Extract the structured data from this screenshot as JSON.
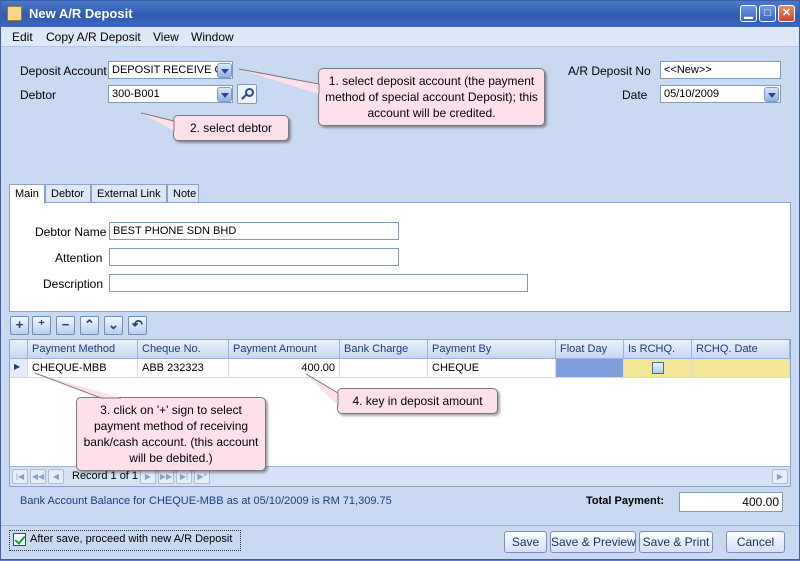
{
  "window": {
    "title": "New A/R Deposit",
    "buttons": [
      "minimize",
      "maximize",
      "close"
    ]
  },
  "menu": [
    "Edit",
    "Copy A/R Deposit",
    "View",
    "Window"
  ],
  "header": {
    "deposit_account_label": "Deposit Account",
    "deposit_account_value": "DEPOSIT RECEIVE CH",
    "debtor_label": "Debtor",
    "debtor_value": "300-B001",
    "ar_deposit_no_label": "A/R Deposit No",
    "ar_deposit_no_value": "<<New>>",
    "date_label": "Date",
    "date_value": "05/10/2009"
  },
  "callouts": {
    "c1": "1. select deposit account (the payment method of special account Deposit); this account will be credited.",
    "c2": "2. select debtor",
    "c3": "3. click on '+' sign to select payment method of receiving bank/cash account. (this account will be debited.)",
    "c4": "4. key in deposit amount"
  },
  "tabs": [
    "Main",
    "Debtor",
    "External Link",
    "Note"
  ],
  "main_tab": {
    "debtor_name_label": "Debtor Name",
    "debtor_name_value": "BEST PHONE SDN BHD",
    "attention_label": "Attention",
    "attention_value": "",
    "description_label": "Description",
    "description_value": ""
  },
  "grid": {
    "columns": [
      "Payment Method",
      "Cheque No.",
      "Payment Amount",
      "Bank Charge",
      "Payment By",
      "Float Day",
      "Is RCHQ.",
      "RCHQ. Date"
    ],
    "rows": [
      {
        "payment_method": "CHEQUE-MBB",
        "cheque_no": "ABB 232323",
        "payment_amount": "400.00",
        "bank_charge": "",
        "payment_by": "CHEQUE",
        "float_day": "",
        "is_rchq": false,
        "rchq_date": ""
      }
    ],
    "navigator_text": "Record 1 of 1"
  },
  "footer": {
    "balance_text": "Bank Account Balance for CHEQUE-MBB as at 05/10/2009 is RM 71,309.75",
    "total_label": "Total Payment:",
    "total_value": "400.00"
  },
  "bottom": {
    "checkbox_label": "After save, proceed with new A/R Deposit",
    "checkbox_checked": true,
    "save": "Save",
    "save_preview": "Save & Preview",
    "save_print": "Save & Print",
    "cancel": "Cancel"
  },
  "colors": {
    "title_bar": "#2e5bb0",
    "window_bg": "#c9d9f1",
    "callout_bg": "#fde0ec",
    "float_day_cell": "#7f9fdc",
    "rchq_cell": "#f3e796"
  }
}
